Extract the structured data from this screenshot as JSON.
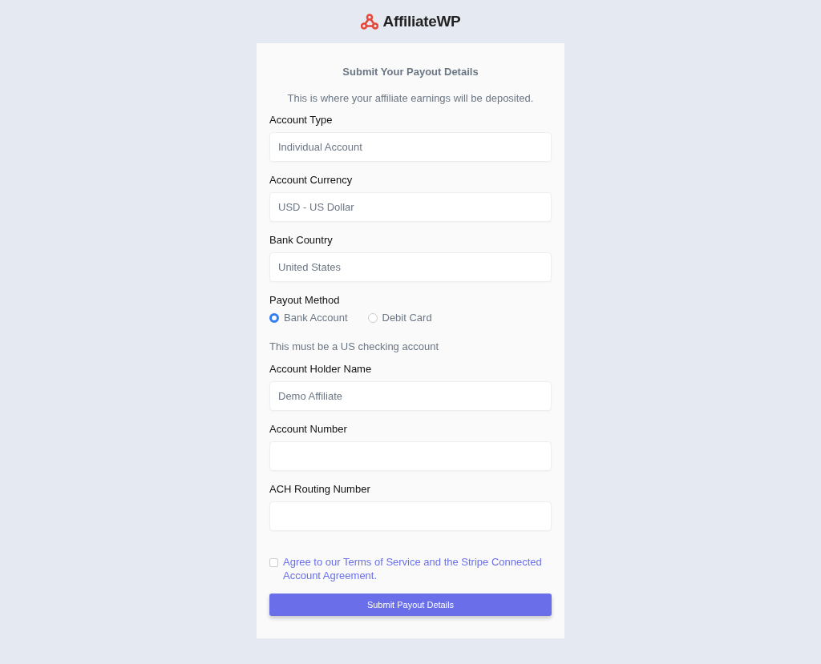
{
  "logo": {
    "text": "AffiliateWP"
  },
  "title": "Submit Your Payout Details",
  "subtitle": "This is where your affiliate earnings will be deposited.",
  "sections": [
    {
      "kind": "field",
      "label": "Account Type",
      "value": "Individual Account"
    },
    {
      "kind": "field",
      "label": "Account Currency",
      "value": "USD - US Dollar"
    },
    {
      "kind": "field",
      "label": "Bank Country",
      "value": "United States"
    },
    {
      "kind": "radio",
      "label": "Payout Method",
      "options": [
        {
          "label": "Bank Account",
          "selected": true
        },
        {
          "label": "Debit Card",
          "selected": false
        }
      ]
    },
    {
      "kind": "note",
      "text": "This must be a US checking account"
    },
    {
      "kind": "field",
      "label": "Account Holder Name",
      "value": "Demo Affiliate"
    },
    {
      "kind": "field",
      "label": "Account Number"
    },
    {
      "kind": "field",
      "label": "ACH Routing Number"
    }
  ],
  "agreement": {
    "checked": false,
    "text": "Agree to our Terms of Service and the Stripe Connected Account Agreement."
  },
  "submit_button": "Submit Payout Details"
}
